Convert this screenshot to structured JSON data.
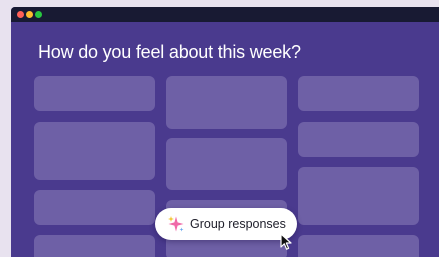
{
  "window": {
    "traffic_lights": [
      {
        "name": "close",
        "color": "#ff5f57"
      },
      {
        "name": "minimize",
        "color": "#febc2e"
      },
      {
        "name": "zoom",
        "color": "#28c840"
      }
    ]
  },
  "main": {
    "heading": "How do you feel about this week?"
  },
  "group_button": {
    "label": "Group responses",
    "icon": "sparkle-icon"
  },
  "colors": {
    "page_background": "#e8e2ef",
    "window_background": "#4a3a8e",
    "titlebar": "#181a33",
    "card": "#6e60a6",
    "button_background": "#ffffff",
    "sparkle_pink": "#f06aa8",
    "sparkle_yellow": "#f4c430",
    "sparkle_blue": "#6aa8f0"
  },
  "cursor": {
    "icon": "cursor-arrow-icon"
  }
}
